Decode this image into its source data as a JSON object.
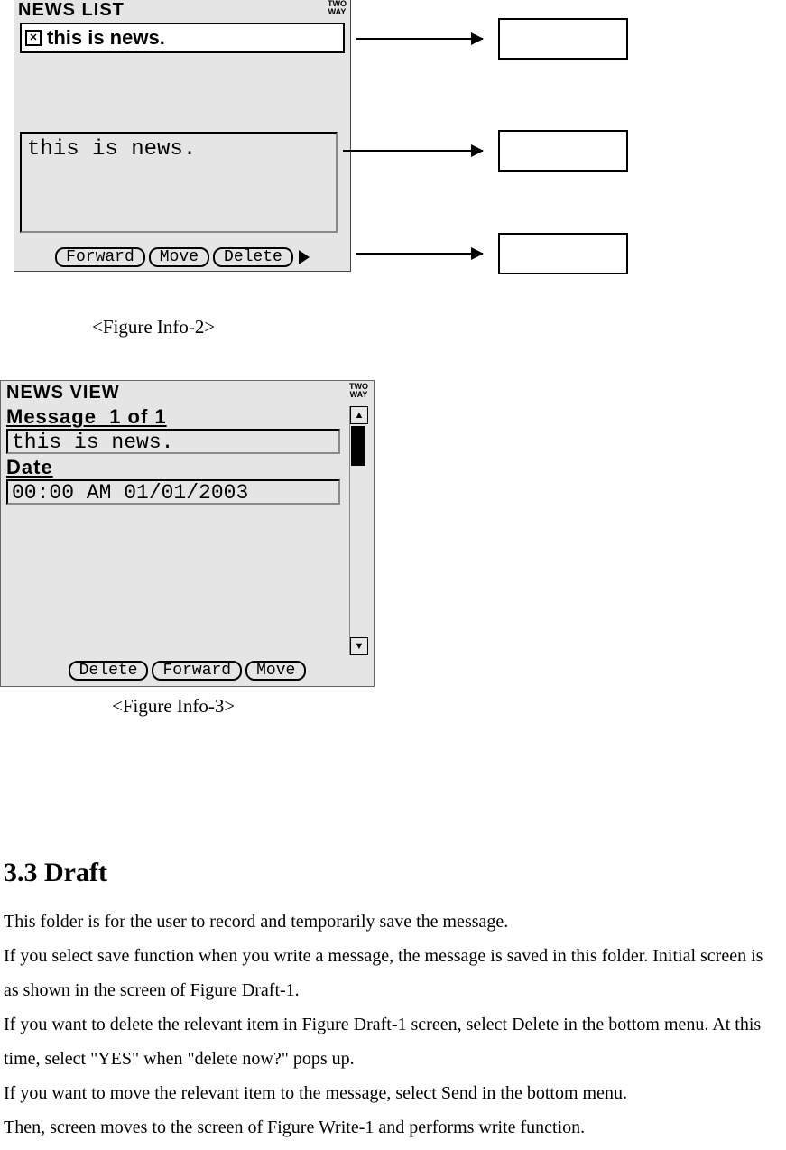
{
  "figure2": {
    "screen_title": "NEWS LIST",
    "status": "TWO\nWAY",
    "list_item": "this is news.",
    "preview": "this is news.",
    "softkeys": [
      "Forward",
      "Move",
      "Delete"
    ],
    "caption": "<Figure Info-2>"
  },
  "figure3": {
    "screen_title": "NEWS VIEW",
    "status": "TWO\nWAY",
    "message_label": "Message  1 of 1",
    "message_value": "this is news.",
    "date_label": "Date",
    "date_value": "00:00 AM 01/01/2003",
    "softkeys": [
      "Delete",
      "Forward",
      "Move"
    ],
    "caption": "<Figure Info-3>"
  },
  "section": {
    "heading": "3.3 Draft",
    "p1": "This folder is for the user to record and temporarily save the message.",
    "p2": "If you select save function when you write a message, the message is saved in this folder. Initial screen is as shown in the screen of Figure Draft-1.",
    "p3": "If you want to delete the relevant item in Figure Draft-1 screen, select Delete in the bottom menu. At this time, select \"YES\" when \"delete now?\" pops up.",
    "p4": "If you want to move the relevant item to the message, select Send in the bottom menu.",
    "p5": "Then, screen moves to the screen of Figure Write-1 and performs write function."
  }
}
